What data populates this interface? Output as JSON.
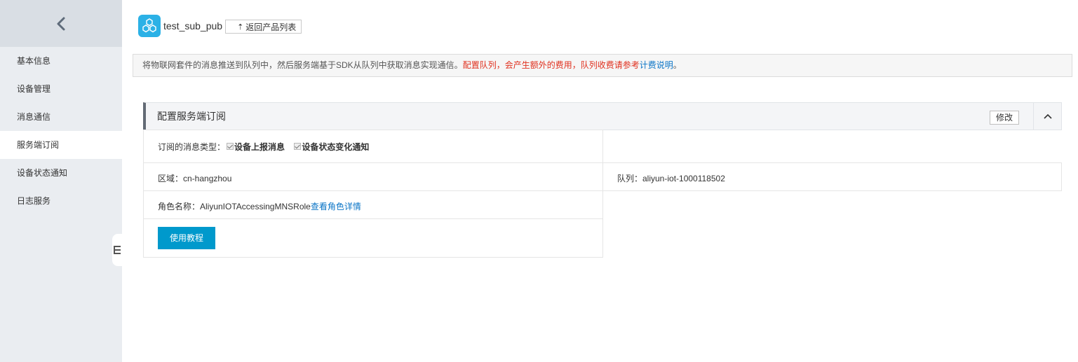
{
  "sidebar": {
    "back_icon": "chevron-left-icon",
    "items": [
      {
        "label": "基本信息"
      },
      {
        "label": "设备管理"
      },
      {
        "label": "消息通信"
      },
      {
        "label": "服务端订阅",
        "active": true
      },
      {
        "label": "设备状态通知"
      },
      {
        "label": "日志服务"
      }
    ]
  },
  "header": {
    "product_icon": "product-cube-icon",
    "product_name": "test_sub_pub",
    "back_button": "返回产品列表"
  },
  "notice": {
    "text": "将物联网套件的消息推送到队列中，然后服务端基于SDK从队列中获取消息实现通信。",
    "warning": "配置队列，会产生额外的费用，队列收费请参考",
    "link": "计费说明",
    "end": "。"
  },
  "panel": {
    "title": "配置服务端订阅",
    "edit_button": "修改",
    "fold_icon": "chevron-up-icon",
    "msg_type_label": "订阅的消息类型：",
    "msg_type_1": "设备上报消息",
    "msg_type_2": "设备状态变化通知",
    "region": "区域：cn-hangzhou",
    "queue": "队列：aliyun-iot-1000118502",
    "role_label": "角色名称：AliyunIOTAccessingMNSRole",
    "role_link": "查看角色详情",
    "tutorial_button": "使用教程"
  },
  "colors": {
    "sidebar_bg": "#eaedf1",
    "primary": "#0099cc",
    "warning": "#e0301e",
    "link": "#0a74c6"
  }
}
